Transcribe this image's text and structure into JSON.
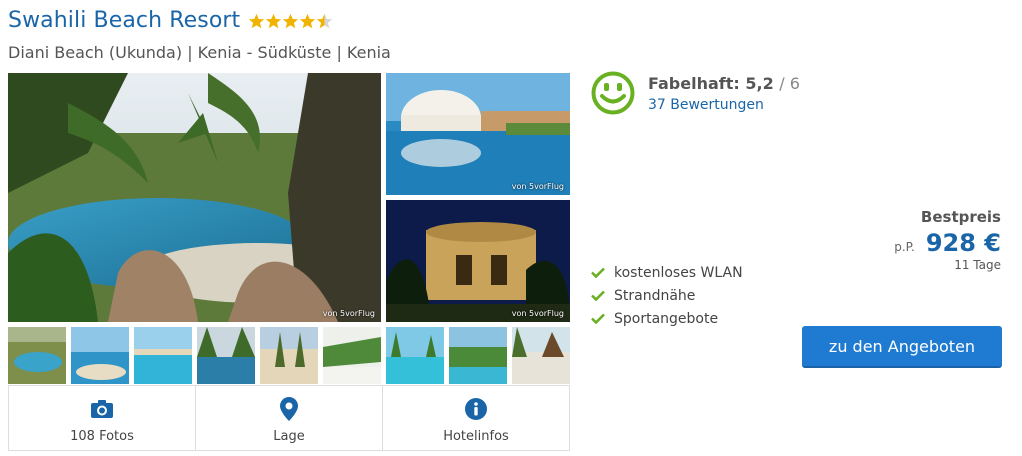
{
  "hotel": {
    "name": "Swahili Beach Resort",
    "stars": 4.5,
    "location": "Diani Beach (Ukunda) | Kenia - Südküste | Kenia"
  },
  "gallery": {
    "credit": "von 5vorFlug",
    "thumb_count": 9
  },
  "actions": {
    "photos_label": "108 Fotos",
    "map_label": "Lage",
    "info_label": "Hotelinfos"
  },
  "rating": {
    "word": "Fabelhaft:",
    "score": "5,2",
    "max": "/ 6",
    "reviews": "37 Bewertungen"
  },
  "features": [
    "kostenloses WLAN",
    "Strandnähe",
    "Sportangebote"
  ],
  "price": {
    "heading": "Bestpreis",
    "per_person": "p.P.",
    "amount": "928 €",
    "duration": "11 Tage"
  },
  "cta": {
    "label": "zu den Angeboten"
  },
  "colors": {
    "link": "#1a65a8",
    "star": "#f0b400",
    "check": "#6ab023",
    "smiley": "#6ab023",
    "button": "#1e7bd1"
  }
}
